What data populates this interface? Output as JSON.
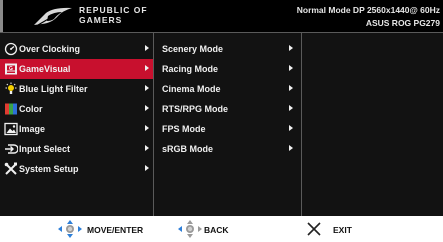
{
  "header": {
    "brand_line1": "REPUBLIC OF",
    "brand_line2": "GAMERS",
    "mode_info": "Normal Mode DP 2560x1440@ 60Hz",
    "model": "ASUS ROG PG279"
  },
  "main_menu": [
    {
      "label": "Over Clocking",
      "icon": "gauge-icon",
      "selected": false
    },
    {
      "label": "GameVisual",
      "icon": "gamevisual-icon",
      "selected": true
    },
    {
      "label": "Blue Light Filter",
      "icon": "bulb-icon",
      "selected": false
    },
    {
      "label": "Color",
      "icon": "color-bars-icon",
      "selected": false
    },
    {
      "label": "Image",
      "icon": "image-icon",
      "selected": false
    },
    {
      "label": "Input Select",
      "icon": "input-select-icon",
      "selected": false
    },
    {
      "label": "System Setup",
      "icon": "tools-icon",
      "selected": false
    }
  ],
  "sub_menu": [
    {
      "label": "Scenery Mode"
    },
    {
      "label": "Racing Mode"
    },
    {
      "label": "Cinema Mode"
    },
    {
      "label": "RTS/RPG Mode"
    },
    {
      "label": "FPS Mode"
    },
    {
      "label": "sRGB Mode"
    }
  ],
  "footer": {
    "move_enter": "MOVE/ENTER",
    "back": "BACK",
    "exit": "EXIT"
  },
  "colors": {
    "selected_row": "#c8102e",
    "dpad_accent": "#2e7fd8"
  }
}
